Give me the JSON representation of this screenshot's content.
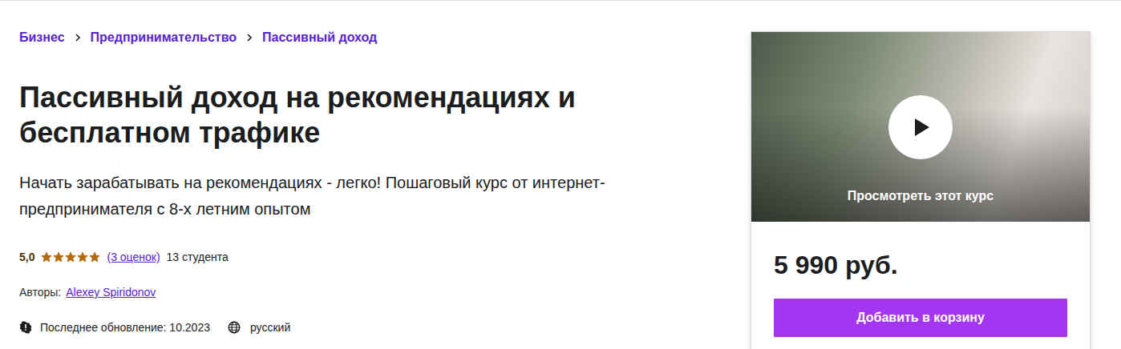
{
  "breadcrumbs": [
    {
      "label": "Бизнес"
    },
    {
      "label": "Предпринимательство"
    },
    {
      "label": "Пассивный доход"
    }
  ],
  "title": "Пассивный доход на рекомендациях и бесплатном трафике",
  "subtitle": "Начать зарабатывать на рекомендациях - легко! Пошаговый курс от интернет-предпринимателя с 8-х летним опытом",
  "rating": {
    "value": "5,0",
    "stars": 5,
    "count": "(3 оценок)",
    "students": "13 студента"
  },
  "authors": {
    "label": "Авторы:",
    "names": [
      "Alexey Spiridonov"
    ]
  },
  "meta": {
    "updated": "Последнее обновление: 10.2023",
    "language": "русский"
  },
  "preview": {
    "caption": "Просмотреть этот курс"
  },
  "price": "5 990 руб.",
  "buttons": [
    "Добавить в корзину"
  ]
}
